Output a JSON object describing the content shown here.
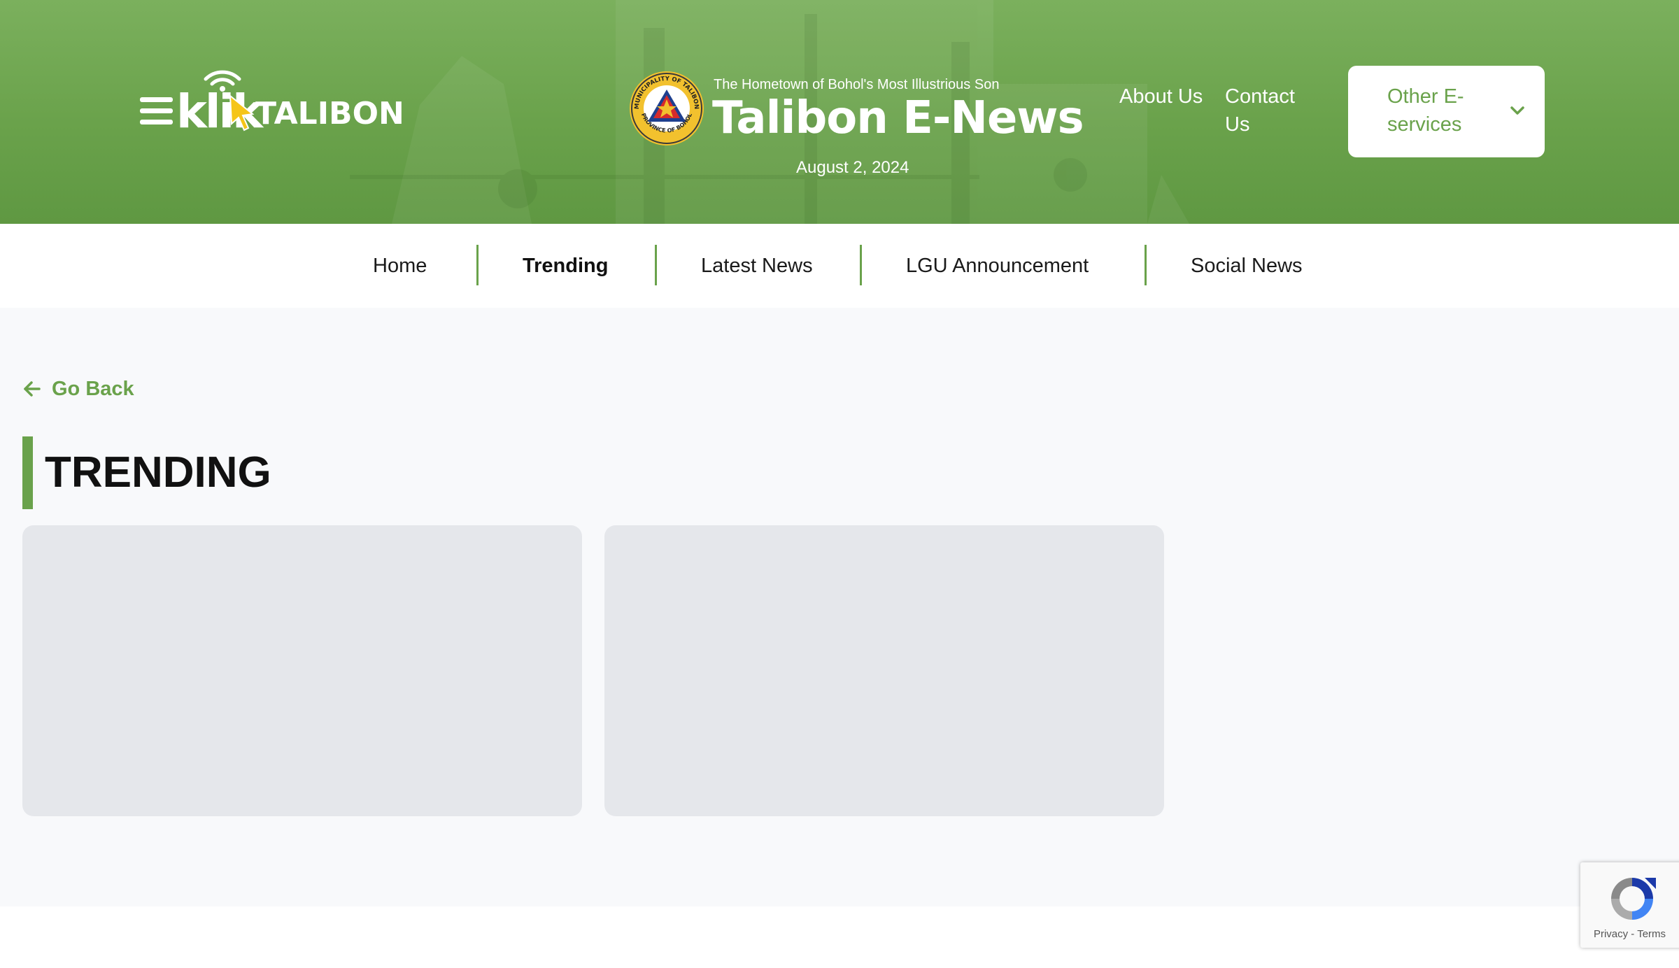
{
  "header": {
    "logo": {
      "klik": "klik",
      "talibon": "TALIBON"
    },
    "tagline": "The Hometown of Bohol's Most Illustrious Son",
    "site_title": "Talibon E-News",
    "date": "August 2, 2024",
    "seal": {
      "top_text": "MUNICIPALITY OF TALIBON",
      "bottom_text": "PROVINCE OF BOHOL"
    },
    "links": [
      {
        "label": "About Us"
      },
      {
        "label": "Contact Us"
      }
    ],
    "eservices": {
      "label": "Other E-services",
      "icon": "chevron-down-icon"
    }
  },
  "nav": {
    "items": [
      {
        "label": "Home",
        "active": false
      },
      {
        "label": "Trending",
        "active": true
      },
      {
        "label": "Latest News",
        "active": false
      },
      {
        "label": "LGU Announcement",
        "active": false
      },
      {
        "label": "Social News",
        "active": false
      }
    ]
  },
  "main": {
    "go_back_label": "Go Back",
    "page_title": "TRENDING",
    "cards": [
      {
        "loading": true
      },
      {
        "loading": true
      }
    ]
  },
  "recaptcha": {
    "privacy": "Privacy",
    "separator": "-",
    "terms": "Terms"
  },
  "colors": {
    "brand_green": "#6aa24b",
    "header_green": "#7bb05d",
    "placeholder_gray": "#e5e7eb",
    "page_bg": "#f8f9fb"
  }
}
